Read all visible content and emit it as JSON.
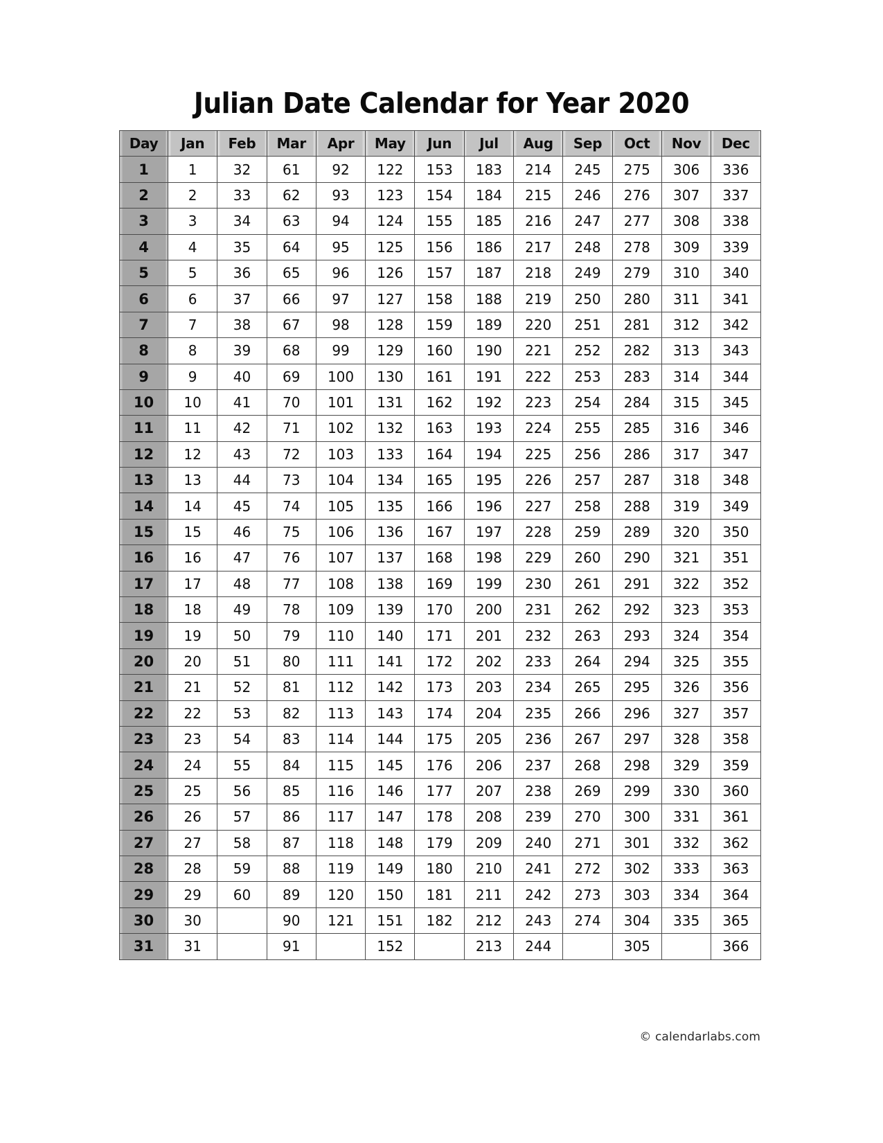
{
  "page": {
    "title": "Julian Date Calendar for Year 2020",
    "year": "2020",
    "footer": "© calendarlabs.com",
    "colors": {
      "day_header_bg": "#a6a6a6",
      "month_header_bg": "#c3c3c3",
      "day_column_bg": "#a6a6a6",
      "cell_bg": "#ffffff",
      "border": "#4a4a4a",
      "text": "#0d0d0d"
    }
  },
  "table": {
    "columns": [
      "Day",
      "Jan",
      "Feb",
      "Mar",
      "Apr",
      "May",
      "Jun",
      "Jul",
      "Aug",
      "Sep",
      "Oct",
      "Nov",
      "Dec"
    ],
    "day_header": "Day",
    "months": [
      "Jan",
      "Feb",
      "Mar",
      "Apr",
      "May",
      "Jun",
      "Jul",
      "Aug",
      "Sep",
      "Oct",
      "Nov",
      "Dec"
    ],
    "days": [
      "1",
      "2",
      "3",
      "4",
      "5",
      "6",
      "7",
      "8",
      "9",
      "10",
      "11",
      "12",
      "13",
      "14",
      "15",
      "16",
      "17",
      "18",
      "19",
      "20",
      "21",
      "22",
      "23",
      "24",
      "25",
      "26",
      "27",
      "28",
      "29",
      "30",
      "31"
    ],
    "rows": [
      {
        "day": "1",
        "values": [
          "1",
          "32",
          "61",
          "92",
          "122",
          "153",
          "183",
          "214",
          "245",
          "275",
          "306",
          "336"
        ]
      },
      {
        "day": "2",
        "values": [
          "2",
          "33",
          "62",
          "93",
          "123",
          "154",
          "184",
          "215",
          "246",
          "276",
          "307",
          "337"
        ]
      },
      {
        "day": "3",
        "values": [
          "3",
          "34",
          "63",
          "94",
          "124",
          "155",
          "185",
          "216",
          "247",
          "277",
          "308",
          "338"
        ]
      },
      {
        "day": "4",
        "values": [
          "4",
          "35",
          "64",
          "95",
          "125",
          "156",
          "186",
          "217",
          "248",
          "278",
          "309",
          "339"
        ]
      },
      {
        "day": "5",
        "values": [
          "5",
          "36",
          "65",
          "96",
          "126",
          "157",
          "187",
          "218",
          "249",
          "279",
          "310",
          "340"
        ]
      },
      {
        "day": "6",
        "values": [
          "6",
          "37",
          "66",
          "97",
          "127",
          "158",
          "188",
          "219",
          "250",
          "280",
          "311",
          "341"
        ]
      },
      {
        "day": "7",
        "values": [
          "7",
          "38",
          "67",
          "98",
          "128",
          "159",
          "189",
          "220",
          "251",
          "281",
          "312",
          "342"
        ]
      },
      {
        "day": "8",
        "values": [
          "8",
          "39",
          "68",
          "99",
          "129",
          "160",
          "190",
          "221",
          "252",
          "282",
          "313",
          "343"
        ]
      },
      {
        "day": "9",
        "values": [
          "9",
          "40",
          "69",
          "100",
          "130",
          "161",
          "191",
          "222",
          "253",
          "283",
          "314",
          "344"
        ]
      },
      {
        "day": "10",
        "values": [
          "10",
          "41",
          "70",
          "101",
          "131",
          "162",
          "192",
          "223",
          "254",
          "284",
          "315",
          "345"
        ]
      },
      {
        "day": "11",
        "values": [
          "11",
          "42",
          "71",
          "102",
          "132",
          "163",
          "193",
          "224",
          "255",
          "285",
          "316",
          "346"
        ]
      },
      {
        "day": "12",
        "values": [
          "12",
          "43",
          "72",
          "103",
          "133",
          "164",
          "194",
          "225",
          "256",
          "286",
          "317",
          "347"
        ]
      },
      {
        "day": "13",
        "values": [
          "13",
          "44",
          "73",
          "104",
          "134",
          "165",
          "195",
          "226",
          "257",
          "287",
          "318",
          "348"
        ]
      },
      {
        "day": "14",
        "values": [
          "14",
          "45",
          "74",
          "105",
          "135",
          "166",
          "196",
          "227",
          "258",
          "288",
          "319",
          "349"
        ]
      },
      {
        "day": "15",
        "values": [
          "15",
          "46",
          "75",
          "106",
          "136",
          "167",
          "197",
          "228",
          "259",
          "289",
          "320",
          "350"
        ]
      },
      {
        "day": "16",
        "values": [
          "16",
          "47",
          "76",
          "107",
          "137",
          "168",
          "198",
          "229",
          "260",
          "290",
          "321",
          "351"
        ]
      },
      {
        "day": "17",
        "values": [
          "17",
          "48",
          "77",
          "108",
          "138",
          "169",
          "199",
          "230",
          "261",
          "291",
          "322",
          "352"
        ]
      },
      {
        "day": "18",
        "values": [
          "18",
          "49",
          "78",
          "109",
          "139",
          "170",
          "200",
          "231",
          "262",
          "292",
          "323",
          "353"
        ]
      },
      {
        "day": "19",
        "values": [
          "19",
          "50",
          "79",
          "110",
          "140",
          "171",
          "201",
          "232",
          "263",
          "293",
          "324",
          "354"
        ]
      },
      {
        "day": "20",
        "values": [
          "20",
          "51",
          "80",
          "111",
          "141",
          "172",
          "202",
          "233",
          "264",
          "294",
          "325",
          "355"
        ]
      },
      {
        "day": "21",
        "values": [
          "21",
          "52",
          "81",
          "112",
          "142",
          "173",
          "203",
          "234",
          "265",
          "295",
          "326",
          "356"
        ]
      },
      {
        "day": "22",
        "values": [
          "22",
          "53",
          "82",
          "113",
          "143",
          "174",
          "204",
          "235",
          "266",
          "296",
          "327",
          "357"
        ]
      },
      {
        "day": "23",
        "values": [
          "23",
          "54",
          "83",
          "114",
          "144",
          "175",
          "205",
          "236",
          "267",
          "297",
          "328",
          "358"
        ]
      },
      {
        "day": "24",
        "values": [
          "24",
          "55",
          "84",
          "115",
          "145",
          "176",
          "206",
          "237",
          "268",
          "298",
          "329",
          "359"
        ]
      },
      {
        "day": "25",
        "values": [
          "25",
          "56",
          "85",
          "116",
          "146",
          "177",
          "207",
          "238",
          "269",
          "299",
          "330",
          "360"
        ]
      },
      {
        "day": "26",
        "values": [
          "26",
          "57",
          "86",
          "117",
          "147",
          "178",
          "208",
          "239",
          "270",
          "300",
          "331",
          "361"
        ]
      },
      {
        "day": "27",
        "values": [
          "27",
          "58",
          "87",
          "118",
          "148",
          "179",
          "209",
          "240",
          "271",
          "301",
          "332",
          "362"
        ]
      },
      {
        "day": "28",
        "values": [
          "28",
          "59",
          "88",
          "119",
          "149",
          "180",
          "210",
          "241",
          "272",
          "302",
          "333",
          "363"
        ]
      },
      {
        "day": "29",
        "values": [
          "29",
          "60",
          "89",
          "120",
          "150",
          "181",
          "211",
          "242",
          "273",
          "303",
          "334",
          "364"
        ]
      },
      {
        "day": "30",
        "values": [
          "30",
          "",
          "90",
          "121",
          "151",
          "182",
          "212",
          "243",
          "274",
          "304",
          "335",
          "365"
        ]
      },
      {
        "day": "31",
        "values": [
          "31",
          "",
          "91",
          "",
          "152",
          "",
          "213",
          "244",
          "",
          "305",
          "",
          "366"
        ]
      }
    ]
  }
}
